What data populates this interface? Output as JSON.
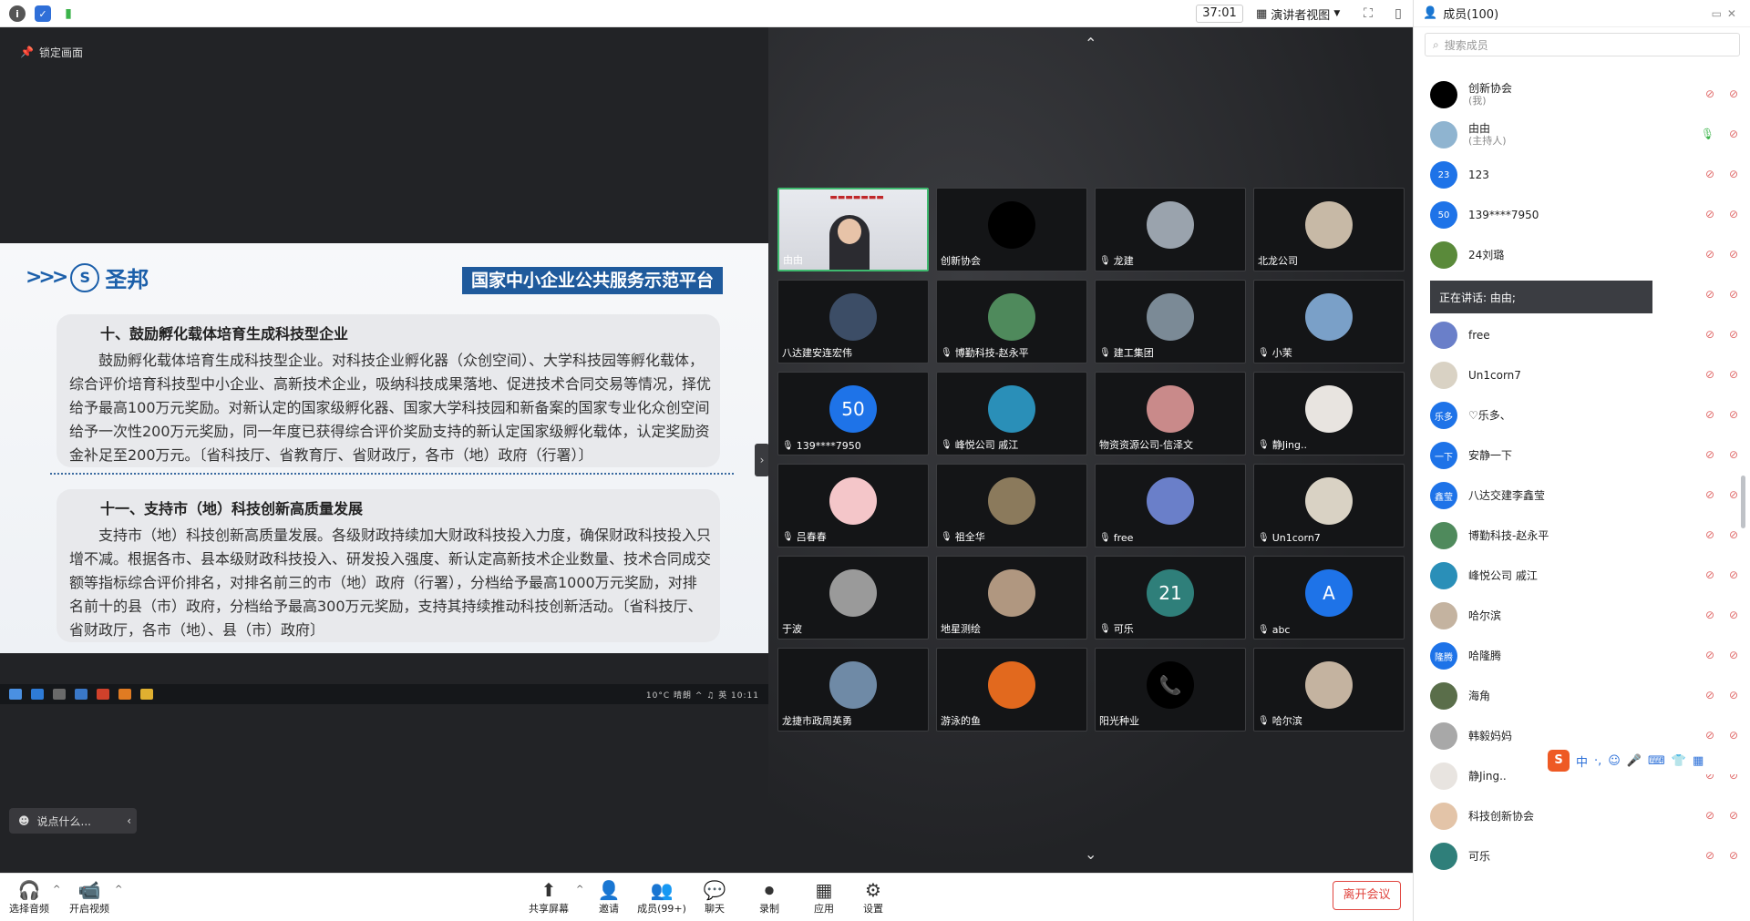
{
  "topbar": {
    "timer": "37:01",
    "view_label": "演讲者视图"
  },
  "share": {
    "lock_label": "锁定画面",
    "chat_placeholder": "说点什么...",
    "slide": {
      "logo_text": "圣邦",
      "banner": "国家中小企业公共服务示范平台",
      "section1_title": "十、鼓励孵化载体培育生成科技型企业",
      "section1_body": "鼓励孵化载体培育生成科技型企业。对科技企业孵化器（众创空间）、大学科技园等孵化载体，综合评价培育科技型中小企业、高新技术企业，吸纳科技成果落地、促进技术合同交易等情况，择优给予最高100万元奖励。对新认定的国家级孵化器、国家大学科技园和新备案的国家专业化众创空间给予一次性200万元奖励，同一年度已获得综合评价奖励支持的新认定国家级孵化载体，认定奖励资金补足至200万元。〔省科技厅、省教育厅、省财政厅，各市（地）政府（行署）〕",
      "section2_title": "十一、支持市（地）科技创新高质量发展",
      "section2_body": "支持市（地）科技创新高质量发展。各级财政持续加大财政科技投入力度，确保财政科技投入只增不减。根据各市、县本级财政科技投入、研发投入强度、新认定高新技术企业数量、技术合同成交额等指标综合评价排名，对排名前三的市（地）政府（行署），分档给予最高1000万元奖励，对排名前十的县（市）政府，分档给予最高300万元奖励，支持其持续推动科技创新活动。〔省科技厅、省财政厅，各市（地）、县（市）政府〕"
    },
    "taskbar_tray": "10°C 晴朗 ^ ♫ 英 10:11"
  },
  "gallery": {
    "tiles": [
      {
        "name": "由由",
        "type": "video",
        "muted": false,
        "avatar_color": "#d0d4da",
        "initial": ""
      },
      {
        "name": "创新协会",
        "type": "avatar",
        "muted": false,
        "avatar_color": "#000000",
        "initial": ""
      },
      {
        "name": "龙建",
        "type": "avatar",
        "muted": true,
        "avatar_color": "#9aa3ad",
        "initial": ""
      },
      {
        "name": "北龙公司",
        "type": "avatar",
        "muted": false,
        "avatar_color": "#c7b9a6",
        "initial": ""
      },
      {
        "name": "八达建安连宏伟",
        "type": "avatar",
        "muted": false,
        "avatar_color": "#3c4d66",
        "initial": ""
      },
      {
        "name": "博勤科技-赵永平",
        "type": "avatar",
        "muted": true,
        "avatar_color": "#4f8a5c",
        "initial": ""
      },
      {
        "name": "建工集团",
        "type": "avatar",
        "muted": true,
        "avatar_color": "#7b8a96",
        "initial": ""
      },
      {
        "name": "小茉",
        "type": "avatar",
        "muted": true,
        "avatar_color": "#7aa0c8",
        "initial": ""
      },
      {
        "name": "139****7950",
        "type": "avatar",
        "muted": true,
        "avatar_color": "#1e73e8",
        "initial": "50"
      },
      {
        "name": "峰悦公司 戚江",
        "type": "avatar",
        "muted": true,
        "avatar_color": "#2a8fb8",
        "initial": ""
      },
      {
        "name": "物资资源公司-信泽文",
        "type": "avatar",
        "muted": false,
        "avatar_color": "#c98a8a",
        "initial": ""
      },
      {
        "name": "静Jing..",
        "type": "avatar",
        "muted": true,
        "avatar_color": "#e8e4e0",
        "initial": ""
      },
      {
        "name": "吕春春",
        "type": "avatar",
        "muted": true,
        "avatar_color": "#f4c6c9",
        "initial": ""
      },
      {
        "name": "祖全华",
        "type": "avatar",
        "muted": true,
        "avatar_color": "#8b7a5c",
        "initial": ""
      },
      {
        "name": "free",
        "type": "avatar",
        "muted": true,
        "avatar_color": "#6a7fc9",
        "initial": ""
      },
      {
        "name": "Un1corn7",
        "type": "avatar",
        "muted": true,
        "avatar_color": "#d9d2c4",
        "initial": ""
      },
      {
        "name": "于波",
        "type": "avatar",
        "muted": false,
        "avatar_color": "#9a9a9a",
        "initial": ""
      },
      {
        "name": "地星测绘",
        "type": "avatar",
        "muted": false,
        "avatar_color": "#b09780",
        "initial": ""
      },
      {
        "name": "可乐",
        "type": "avatar",
        "muted": true,
        "avatar_color": "#2f7f7a",
        "initial": "21"
      },
      {
        "name": "abc",
        "type": "avatar",
        "muted": true,
        "avatar_color": "#1e73e8",
        "initial": "A"
      },
      {
        "name": "龙捷市政周英勇",
        "type": "avatar",
        "muted": false,
        "avatar_color": "#6f8aa6",
        "initial": ""
      },
      {
        "name": "游泳的鱼",
        "type": "avatar",
        "muted": false,
        "avatar_color": "#e2691e",
        "initial": ""
      },
      {
        "name": "阳光种业",
        "type": "avatar",
        "muted": false,
        "avatar_color": "#000000",
        "initial": "📞"
      },
      {
        "name": "哈尔滨",
        "type": "avatar",
        "muted": true,
        "avatar_color": "#c4b3a0",
        "initial": ""
      }
    ]
  },
  "panel": {
    "title": "成员(100)",
    "search_placeholder": "搜索成员",
    "speaking_label": "正在讲话: 由由;",
    "members": [
      {
        "name": "创新协会",
        "role": "(我)",
        "avatar_color": "#000000",
        "initial": ""
      },
      {
        "name": "由由",
        "role": "(主持人)",
        "avatar_color": "#8fb4d0",
        "initial": ""
      },
      {
        "name": "123",
        "role": "",
        "avatar_color": "#1e73e8",
        "initial": "23"
      },
      {
        "name": "139****7950",
        "role": "",
        "avatar_color": "#1e73e8",
        "initial": "50"
      },
      {
        "name": "24刘璐",
        "role": "",
        "avatar_color": "#5a8a3a",
        "initial": ""
      },
      {
        "name": "",
        "role": "",
        "avatar_color": "#ffffff",
        "initial": ""
      },
      {
        "name": "free",
        "role": "",
        "avatar_color": "#6a7fc9",
        "initial": ""
      },
      {
        "name": "Un1corn7",
        "role": "",
        "avatar_color": "#d9d2c4",
        "initial": ""
      },
      {
        "name": "♡乐多、",
        "role": "",
        "avatar_color": "#1e73e8",
        "initial": "乐多"
      },
      {
        "name": "安静一下",
        "role": "",
        "avatar_color": "#1e73e8",
        "initial": "一下"
      },
      {
        "name": "八达交建李鑫莹",
        "role": "",
        "avatar_color": "#1e73e8",
        "initial": "鑫莹"
      },
      {
        "name": "博勤科技-赵永平",
        "role": "",
        "avatar_color": "#4f8a5c",
        "initial": ""
      },
      {
        "name": "峰悦公司 戚江",
        "role": "",
        "avatar_color": "#2a8fb8",
        "initial": ""
      },
      {
        "name": "哈尔滨",
        "role": "",
        "avatar_color": "#c4b3a0",
        "initial": ""
      },
      {
        "name": "哈隆腾",
        "role": "",
        "avatar_color": "#1e73e8",
        "initial": "隆腾"
      },
      {
        "name": "海角",
        "role": "",
        "avatar_color": "#5a6e4a",
        "initial": ""
      },
      {
        "name": "韩毅妈妈",
        "role": "",
        "avatar_color": "#a8a8a8",
        "initial": ""
      },
      {
        "name": "静Jing..",
        "role": "",
        "avatar_color": "#e8e4e0",
        "initial": ""
      },
      {
        "name": "科技创新协会",
        "role": "",
        "avatar_color": "#e3c4a8",
        "initial": ""
      },
      {
        "name": "可乐",
        "role": "",
        "avatar_color": "#2f7f7a",
        "initial": ""
      }
    ],
    "ime_label": "中"
  },
  "toolbar": {
    "audio": "选择音频",
    "video": "开启视频",
    "share": "共享屏幕",
    "invite": "邀请",
    "members": "成员(99+)",
    "chat": "聊天",
    "record": "录制",
    "apps": "应用",
    "settings": "设置",
    "leave": "离开会议"
  }
}
